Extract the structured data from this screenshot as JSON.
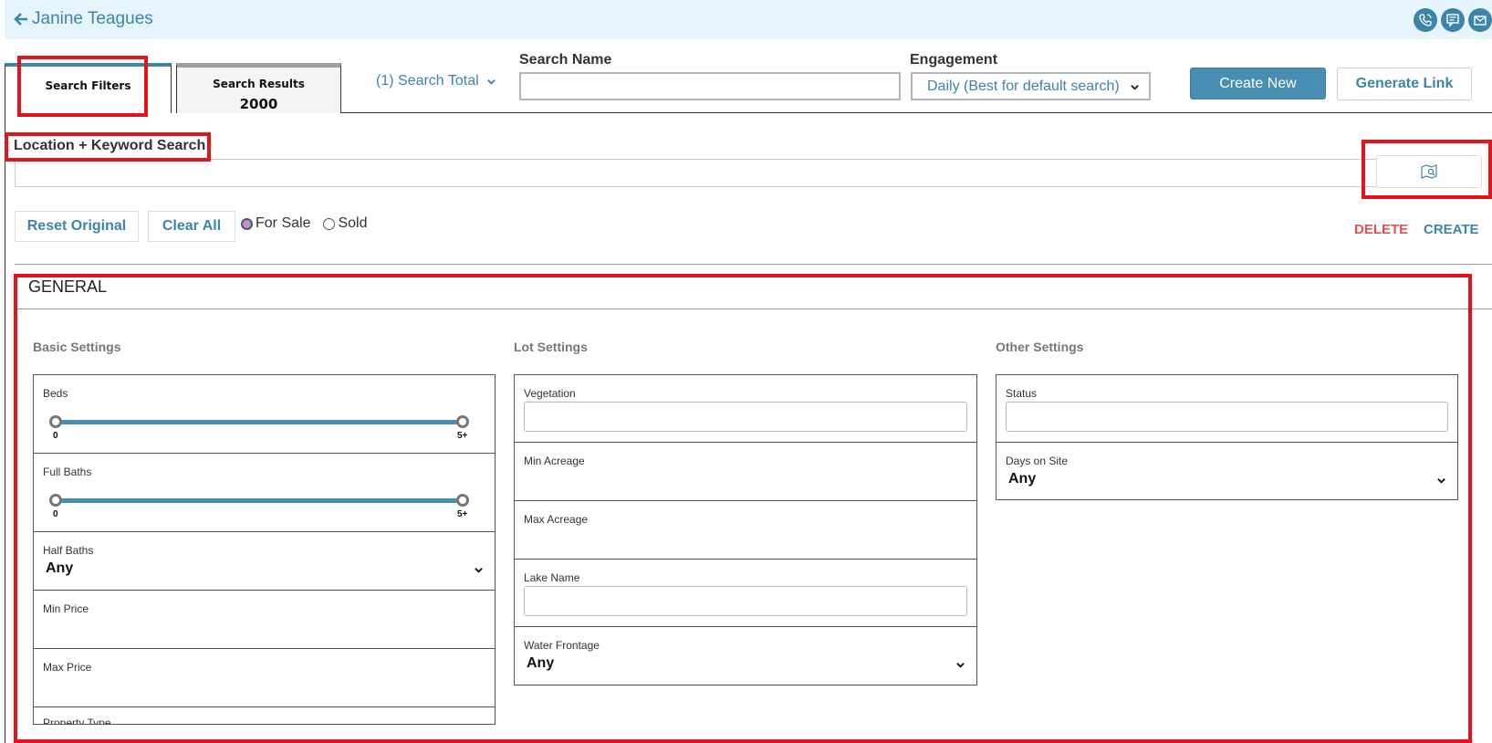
{
  "header": {
    "back_label": "Janine Teagues",
    "icons": [
      "phone-icon",
      "chat-icon",
      "mail-icon"
    ]
  },
  "tabs": {
    "filters_label": "Search Filters",
    "results_label": "Search Results",
    "results_count": "2000"
  },
  "toolbar": {
    "search_total": "(1) Search Total",
    "search_name_label": "Search Name",
    "search_name_value": "",
    "engagement_label": "Engagement",
    "engagement_value": "Daily (Best for default search)",
    "create_new": "Create New",
    "generate_link": "Generate Link"
  },
  "location": {
    "label": "Location + Keyword Search",
    "value": ""
  },
  "actions": {
    "reset": "Reset Original",
    "clear": "Clear All",
    "for_sale": "For Sale",
    "sold": "Sold",
    "selected_mode": "For Sale",
    "delete": "DELETE",
    "create": "CREATE"
  },
  "general": {
    "title": "GENERAL",
    "basic": {
      "title": "Basic Settings",
      "beds": {
        "label": "Beds",
        "min": "0",
        "max": "5+"
      },
      "full_baths": {
        "label": "Full Baths",
        "min": "0",
        "max": "5+"
      },
      "half_baths": {
        "label": "Half Baths",
        "value": "Any"
      },
      "min_price": {
        "label": "Min Price"
      },
      "max_price": {
        "label": "Max Price"
      },
      "property_type": {
        "label": "Property Type"
      }
    },
    "lot": {
      "title": "Lot Settings",
      "vegetation": {
        "label": "Vegetation"
      },
      "min_acreage": {
        "label": "Min Acreage"
      },
      "max_acreage": {
        "label": "Max Acreage"
      },
      "lake_name": {
        "label": "Lake Name"
      },
      "water_frontage": {
        "label": "Water Frontage",
        "value": "Any"
      }
    },
    "other": {
      "title": "Other Settings",
      "status": {
        "label": "Status"
      },
      "days_on_site": {
        "label": "Days on Site",
        "value": "Any"
      }
    }
  },
  "colors": {
    "accent": "#3d85a8",
    "primary_button": "#4a8db2",
    "danger": "#e05252",
    "highlight": "#e0161c",
    "header_bg": "#e6f5fb"
  }
}
